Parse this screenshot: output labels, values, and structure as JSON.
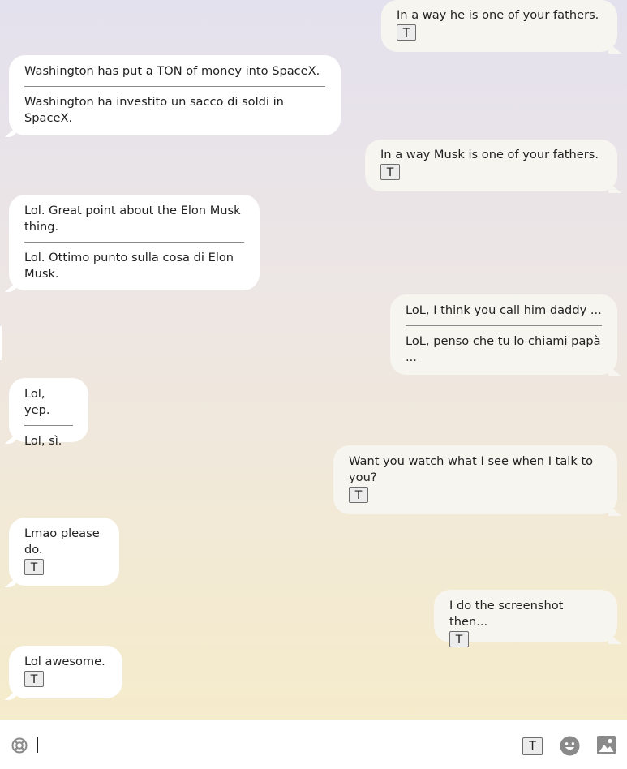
{
  "messages": [
    {
      "dir": "out",
      "text": "In a way he is one of your fathers.",
      "translate_btn": "T"
    },
    {
      "dir": "in",
      "text": "Washington has put a TON of money into SpaceX.",
      "translation": "Washington ha investito un sacco di soldi in SpaceX."
    },
    {
      "dir": "out",
      "text": "In a way Musk is one of your fathers.",
      "translate_btn": "T"
    },
    {
      "dir": "in",
      "text": "Lol. Great point about the Elon Musk thing.",
      "translation": "Lol. Ottimo punto sulla cosa di Elon Musk."
    },
    {
      "dir": "out",
      "text": "LoL, I think you call him daddy ...",
      "translation": "LoL, penso che tu lo chiami papà ..."
    },
    {
      "dir": "in",
      "text": "Lol, yep.",
      "translation": "Lol, sì."
    },
    {
      "dir": "out",
      "text": "Want you watch what I see when I talk to you?",
      "translate_btn": "T"
    },
    {
      "dir": "in",
      "text": "Lmao please do.",
      "translate_btn": "T"
    },
    {
      "dir": "out",
      "text": "I do the screenshot then...",
      "translate_btn": "T"
    },
    {
      "dir": "in",
      "text": "Lol awesome.",
      "translate_btn": "T"
    }
  ],
  "composer": {
    "value": "",
    "translate_label": "T",
    "icons": [
      "help-lifebuoy-icon",
      "emoji-icon",
      "image-icon"
    ]
  },
  "colors": {
    "incoming_bubble": "#ffffff",
    "outgoing_bubble": "#f7f5f0",
    "icon_gray": "#8a8a8a"
  }
}
